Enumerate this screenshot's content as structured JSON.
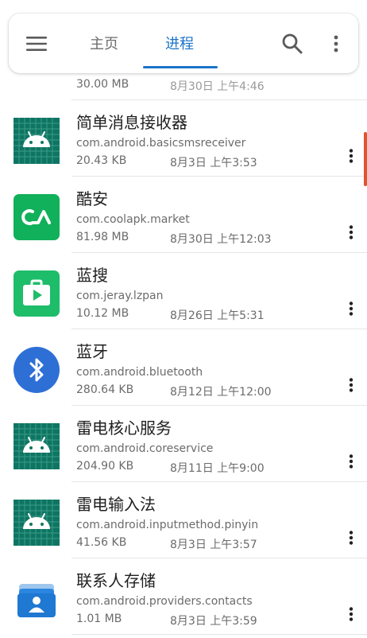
{
  "header": {
    "tabs": [
      {
        "label": "主页",
        "selected": false
      },
      {
        "label": "进程",
        "selected": true
      }
    ],
    "icons": [
      "menu-icon",
      "search-icon",
      "more-vert-icon"
    ],
    "accent_color": "#1a73c8"
  },
  "partial_row": {
    "size": "30.00 MB",
    "date": "8月30日 上午4:46"
  },
  "processes": [
    {
      "name": "简单消息接收器",
      "package": "com.android.basicsmsreceiver",
      "size": "20.43 KB",
      "date": "8月3日 上午3:53",
      "icon": "android-icon"
    },
    {
      "name": "酷安",
      "package": "com.coolapk.market",
      "size": "81.98 MB",
      "date": "8月30日 上午12:03",
      "icon": "coolapk-icon"
    },
    {
      "name": "蓝搜",
      "package": "com.jeray.lzpan",
      "size": "10.12 MB",
      "date": "8月26日 上午5:31",
      "icon": "lansou-icon"
    },
    {
      "name": "蓝牙",
      "package": "com.android.bluetooth",
      "size": "280.64 KB",
      "date": "8月12日 上午12:00",
      "icon": "bluetooth-icon"
    },
    {
      "name": "雷电核心服务",
      "package": "com.android.coreservice",
      "size": "204.90 KB",
      "date": "8月11日 上午9:00",
      "icon": "android-icon"
    },
    {
      "name": "雷电输入法",
      "package": "com.android.inputmethod.pinyin",
      "size": "41.56 KB",
      "date": "8月3日 上午3:57",
      "icon": "android-icon"
    },
    {
      "name": "联系人存储",
      "package": "com.android.providers.contacts",
      "size": "1.01 MB",
      "date": "8月3日 上午3:59",
      "icon": "contacts-storage-icon"
    }
  ]
}
